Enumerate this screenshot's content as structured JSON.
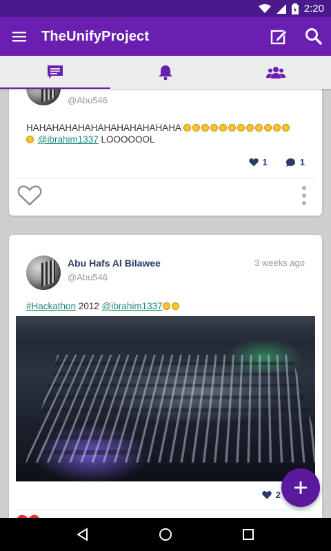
{
  "status_bar": {
    "time": "2:20",
    "icons": [
      "wifi-icon",
      "signal-icon",
      "battery-icon"
    ]
  },
  "app_bar": {
    "title": "TheUnifyProject",
    "actions": [
      "compose-icon",
      "search-icon"
    ]
  },
  "tabs": [
    {
      "name": "messages",
      "icon": "chat-icon",
      "active": true
    },
    {
      "name": "notifications",
      "icon": "bell-icon",
      "active": false
    },
    {
      "name": "groups",
      "icon": "people-icon",
      "active": false
    }
  ],
  "posts": [
    {
      "handle": "@Abu546",
      "text": "HAHAHAHAHAHAHAHAHAHAHAHA",
      "mention": "@ibrahim1337",
      "text_tail": "LOOOOOOL",
      "likes": "1",
      "comments": "1"
    },
    {
      "author": "Abu Hafs Al Bilawee",
      "handle": "@Abu546",
      "time": "3 weeks ago",
      "hashtag": "#Hackathon",
      "text_mid": "2012",
      "mention": "@ibrahim1337",
      "likes": "2"
    }
  ],
  "colors": {
    "primary": "#6a1fb0",
    "status": "#4a1a8c",
    "link": "#1a8a7a",
    "fab": "#5b1a9e"
  }
}
